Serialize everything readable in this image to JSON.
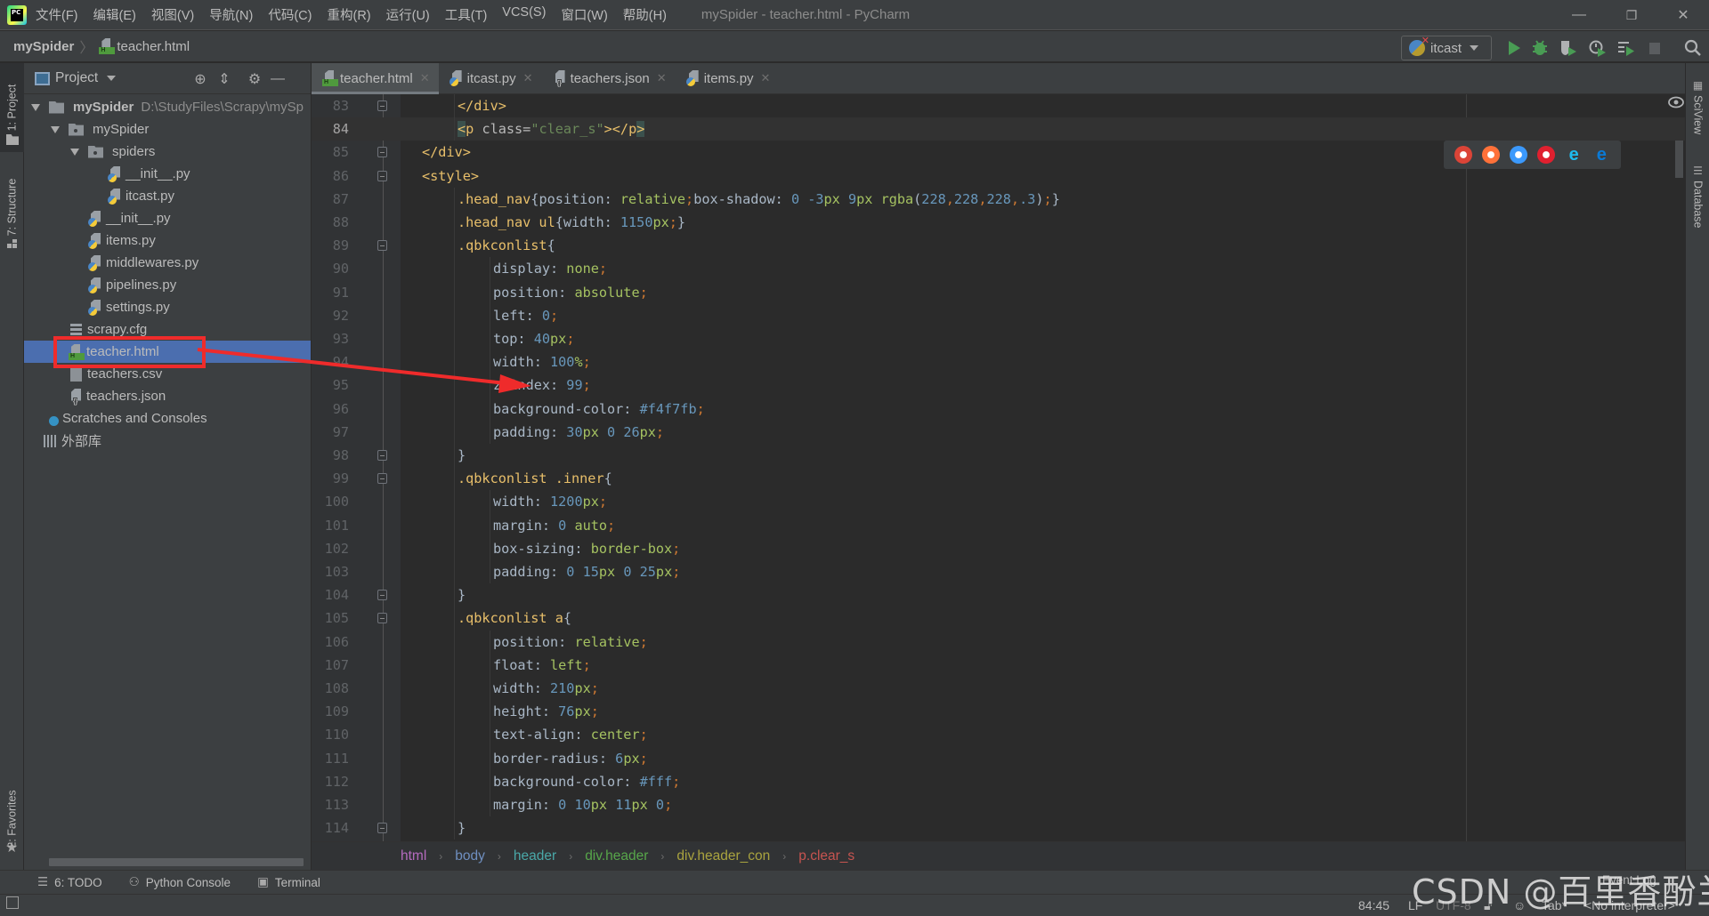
{
  "app": {
    "window_title": "mySpider - teacher.html - PyCharm",
    "menu": [
      "文件(F)",
      "编辑(E)",
      "视图(V)",
      "导航(N)",
      "代码(C)",
      "重构(R)",
      "运行(U)",
      "工具(T)",
      "VCS(S)",
      "窗口(W)",
      "帮助(H)"
    ],
    "window_controls": {
      "minimize": "—",
      "restore": "❐",
      "close": "✕"
    }
  },
  "navbar": {
    "root": "mySpider",
    "file": "teacher.html",
    "run_config": "itcast"
  },
  "left_strip": {
    "project_tab": "1: Project",
    "structure_tab": "7: Structure",
    "favorites_tab": "2: Favorites"
  },
  "right_strip": {
    "sciview_tab": "SciView",
    "database_tab": "Database"
  },
  "project_panel": {
    "title": "Project",
    "tree": [
      {
        "label": "mySpider",
        "path": "D:\\StudyFiles\\Scrapy\\mySp",
        "type": "root-folder",
        "depth": 0,
        "expanded": true
      },
      {
        "label": "mySpider",
        "type": "package",
        "depth": 1,
        "expanded": true
      },
      {
        "label": "spiders",
        "type": "package",
        "depth": 2,
        "expanded": true
      },
      {
        "label": "__init__.py",
        "type": "python",
        "depth": 3
      },
      {
        "label": "itcast.py",
        "type": "python",
        "depth": 3
      },
      {
        "label": "__init__.py",
        "type": "python",
        "depth": 2
      },
      {
        "label": "items.py",
        "type": "python",
        "depth": 2
      },
      {
        "label": "middlewares.py",
        "type": "python",
        "depth": 2
      },
      {
        "label": "pipelines.py",
        "type": "python",
        "depth": 2
      },
      {
        "label": "settings.py",
        "type": "python",
        "depth": 2
      },
      {
        "label": "scrapy.cfg",
        "type": "config",
        "depth": 1
      },
      {
        "label": "teacher.html",
        "type": "html",
        "depth": 1,
        "selected": true
      },
      {
        "label": "teachers.csv",
        "type": "csv",
        "depth": 1
      },
      {
        "label": "teachers.json",
        "type": "json",
        "depth": 1
      },
      {
        "label": "Scratches and Consoles",
        "type": "scratches",
        "depth": 0
      },
      {
        "label": "外部库",
        "type": "libraries",
        "depth": 0
      }
    ]
  },
  "tabs": [
    {
      "label": "teacher.html",
      "type": "html",
      "active": true
    },
    {
      "label": "itcast.py",
      "type": "python"
    },
    {
      "label": "teachers.json",
      "type": "json"
    },
    {
      "label": "items.py",
      "type": "python"
    }
  ],
  "editor": {
    "current_line": 84,
    "lines": [
      {
        "n": "83",
        "fold": true,
        "indent": 2,
        "tokens": [
          [
            "t",
            "</div>"
          ]
        ]
      },
      {
        "n": "84",
        "indent": 2,
        "tokens": [
          [
            "t br",
            "<"
          ],
          [
            "t",
            "p "
          ],
          [
            "a",
            "class="
          ],
          [
            "s",
            "\"clear_s\""
          ],
          [
            "t",
            ">"
          ],
          [
            "t",
            "</p"
          ],
          [
            "t br",
            ">"
          ]
        ]
      },
      {
        "n": "85",
        "fold": true,
        "indent": 1,
        "tokens": [
          [
            "t",
            "</div>"
          ]
        ]
      },
      {
        "n": "86",
        "fold": true,
        "indent": 1,
        "tokens": [
          [
            "t",
            "<style>"
          ]
        ]
      },
      {
        "n": "87",
        "indent": 2,
        "tokens": [
          [
            "t",
            ".head_nav"
          ],
          [
            "p",
            "{position: "
          ],
          [
            "k",
            "relative"
          ],
          [
            "o",
            ";"
          ],
          [
            "p",
            "box-shadow: "
          ],
          [
            "n",
            "0 "
          ],
          [
            "n",
            "-3"
          ],
          [
            "k",
            "px "
          ],
          [
            "n",
            "9"
          ],
          [
            "k",
            "px "
          ],
          [
            "k",
            "rgba"
          ],
          [
            "p",
            "("
          ],
          [
            "n",
            "228"
          ],
          [
            "o",
            ","
          ],
          [
            "n",
            "228"
          ],
          [
            "o",
            ","
          ],
          [
            "n",
            "228"
          ],
          [
            "o",
            ","
          ],
          [
            "n",
            ".3"
          ],
          [
            "p",
            ")"
          ],
          [
            "o",
            ";"
          ],
          [
            "p",
            "}"
          ]
        ]
      },
      {
        "n": "88",
        "indent": 2,
        "tokens": [
          [
            "t",
            ".head_nav ul"
          ],
          [
            "p",
            "{width: "
          ],
          [
            "n",
            "1150"
          ],
          [
            "k",
            "px"
          ],
          [
            "o",
            ";"
          ],
          [
            "p",
            "}"
          ]
        ]
      },
      {
        "n": "89",
        "fold": true,
        "indent": 2,
        "tokens": [
          [
            "t",
            ".qbkconlist"
          ],
          [
            "p",
            "{"
          ]
        ]
      },
      {
        "n": "90",
        "indent": 3,
        "tokens": [
          [
            "p",
            "display: "
          ],
          [
            "k",
            "none"
          ],
          [
            "o",
            ";"
          ]
        ]
      },
      {
        "n": "91",
        "indent": 3,
        "tokens": [
          [
            "p",
            "position: "
          ],
          [
            "k",
            "absolute"
          ],
          [
            "o",
            ";"
          ]
        ]
      },
      {
        "n": "92",
        "indent": 3,
        "tokens": [
          [
            "p",
            "left: "
          ],
          [
            "n",
            "0"
          ],
          [
            "o",
            ";"
          ]
        ]
      },
      {
        "n": "93",
        "indent": 3,
        "tokens": [
          [
            "p",
            "top: "
          ],
          [
            "n",
            "40"
          ],
          [
            "k",
            "px"
          ],
          [
            "o",
            ";"
          ]
        ]
      },
      {
        "n": "94",
        "indent": 3,
        "tokens": [
          [
            "p",
            "width: "
          ],
          [
            "n",
            "100"
          ],
          [
            "k",
            "%"
          ],
          [
            "o",
            ";"
          ]
        ]
      },
      {
        "n": "95",
        "indent": 3,
        "tokens": [
          [
            "p",
            "z-index: "
          ],
          [
            "n",
            "99"
          ],
          [
            "o",
            ";"
          ]
        ]
      },
      {
        "n": "96",
        "indent": 3,
        "tokens": [
          [
            "p",
            "background-color: "
          ],
          [
            "n",
            "#f4f7fb"
          ],
          [
            "o",
            ";"
          ]
        ]
      },
      {
        "n": "97",
        "indent": 3,
        "tokens": [
          [
            "p",
            "padding: "
          ],
          [
            "n",
            "30"
          ],
          [
            "k",
            "px "
          ],
          [
            "n",
            "0 "
          ],
          [
            "n",
            "26"
          ],
          [
            "k",
            "px"
          ],
          [
            "o",
            ";"
          ]
        ]
      },
      {
        "n": "98",
        "fold": true,
        "indent": 2,
        "tokens": [
          [
            "p",
            "}"
          ]
        ]
      },
      {
        "n": "99",
        "fold": true,
        "indent": 2,
        "tokens": [
          [
            "t",
            ".qbkconlist .inner"
          ],
          [
            "p",
            "{"
          ]
        ]
      },
      {
        "n": "100",
        "indent": 3,
        "tokens": [
          [
            "p",
            "width: "
          ],
          [
            "n",
            "1200"
          ],
          [
            "k",
            "px"
          ],
          [
            "o",
            ";"
          ]
        ]
      },
      {
        "n": "101",
        "indent": 3,
        "tokens": [
          [
            "p",
            "margin: "
          ],
          [
            "n",
            "0 "
          ],
          [
            "k",
            "auto"
          ],
          [
            "o",
            ";"
          ]
        ]
      },
      {
        "n": "102",
        "indent": 3,
        "tokens": [
          [
            "p",
            "box-sizing: "
          ],
          [
            "k",
            "border-box"
          ],
          [
            "o",
            ";"
          ]
        ]
      },
      {
        "n": "103",
        "indent": 3,
        "tokens": [
          [
            "p",
            "padding: "
          ],
          [
            "n",
            "0 "
          ],
          [
            "n",
            "15"
          ],
          [
            "k",
            "px "
          ],
          [
            "n",
            "0 "
          ],
          [
            "n",
            "25"
          ],
          [
            "k",
            "px"
          ],
          [
            "o",
            ";"
          ]
        ]
      },
      {
        "n": "104",
        "fold": true,
        "indent": 2,
        "tokens": [
          [
            "p",
            "}"
          ]
        ]
      },
      {
        "n": "105",
        "fold": true,
        "indent": 2,
        "tokens": [
          [
            "t",
            ".qbkconlist a"
          ],
          [
            "p",
            "{"
          ]
        ]
      },
      {
        "n": "106",
        "indent": 3,
        "tokens": [
          [
            "p",
            "position: "
          ],
          [
            "k",
            "relative"
          ],
          [
            "o",
            ";"
          ]
        ]
      },
      {
        "n": "107",
        "indent": 3,
        "tokens": [
          [
            "p",
            "float: "
          ],
          [
            "k",
            "left"
          ],
          [
            "o",
            ";"
          ]
        ]
      },
      {
        "n": "108",
        "indent": 3,
        "tokens": [
          [
            "p",
            "width: "
          ],
          [
            "n",
            "210"
          ],
          [
            "k",
            "px"
          ],
          [
            "o",
            ";"
          ]
        ]
      },
      {
        "n": "109",
        "indent": 3,
        "tokens": [
          [
            "p",
            "height: "
          ],
          [
            "n",
            "76"
          ],
          [
            "k",
            "px"
          ],
          [
            "o",
            ";"
          ]
        ]
      },
      {
        "n": "110",
        "indent": 3,
        "tokens": [
          [
            "p",
            "text-align: "
          ],
          [
            "k",
            "center"
          ],
          [
            "o",
            ";"
          ]
        ]
      },
      {
        "n": "111",
        "indent": 3,
        "tokens": [
          [
            "p",
            "border-radius: "
          ],
          [
            "n",
            "6"
          ],
          [
            "k",
            "px"
          ],
          [
            "o",
            ";"
          ]
        ]
      },
      {
        "n": "112",
        "indent": 3,
        "tokens": [
          [
            "p",
            "background-color: "
          ],
          [
            "n",
            "#fff"
          ],
          [
            "o",
            ";"
          ]
        ]
      },
      {
        "n": "113",
        "indent": 3,
        "tokens": [
          [
            "p",
            "margin: "
          ],
          [
            "n",
            "0 "
          ],
          [
            "n",
            "10"
          ],
          [
            "k",
            "px "
          ],
          [
            "n",
            "11"
          ],
          [
            "k",
            "px "
          ],
          [
            "n",
            "0"
          ],
          [
            "o",
            ";"
          ]
        ]
      },
      {
        "n": "114",
        "fold": true,
        "indent": 2,
        "tokens": [
          [
            "p",
            "}"
          ]
        ]
      }
    ]
  },
  "browser_popup": [
    {
      "name": "chrome",
      "color": "#db4437"
    },
    {
      "name": "firefox",
      "color": "#ff7139"
    },
    {
      "name": "safari",
      "color": "#3b99fc"
    },
    {
      "name": "opera",
      "color": "#e0202f"
    },
    {
      "name": "internet-explorer",
      "color": "#1ebbee"
    },
    {
      "name": "edge",
      "color": "#0a7ad6"
    }
  ],
  "breadcrumbs": [
    {
      "label": "html",
      "color": "#b56bbf"
    },
    {
      "label": "body",
      "color": "#6f8fc0"
    },
    {
      "label": "header",
      "color": "#4aa8a8"
    },
    {
      "label": "div.header",
      "color": "#57a64a"
    },
    {
      "label": "div.header_con",
      "color": "#a9a33f"
    },
    {
      "label": "p.clear_s",
      "color": "#c75450"
    }
  ],
  "bottom_tabs": [
    {
      "label": "6: TODO",
      "icon": "list-icon"
    },
    {
      "label": "Python Console",
      "icon": "python-icon"
    },
    {
      "label": "Terminal",
      "icon": "terminal-icon"
    }
  ],
  "status": {
    "position": "84:45",
    "line_sep": "LF",
    "encoding": "UTF-8",
    "indent": "Tab*",
    "interpreter": "<No interpreter>",
    "event_log": "Event Log"
  },
  "watermark": "CSDN @百里香酚兰"
}
